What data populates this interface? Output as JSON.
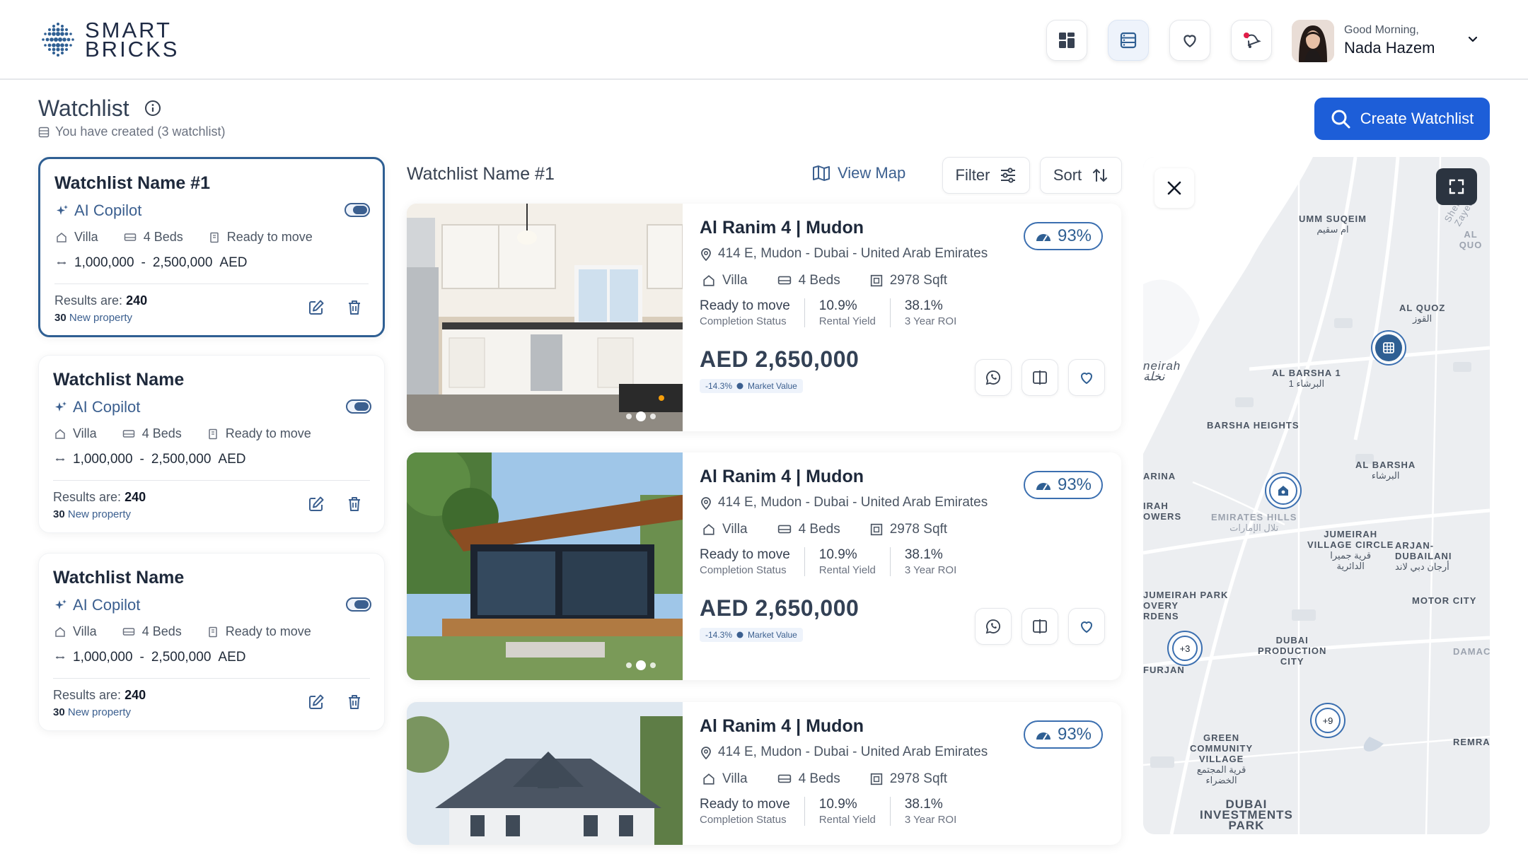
{
  "brand": {
    "line1": "SMART",
    "line2": "BRICKS"
  },
  "user": {
    "greeting": "Good Morning,",
    "name": "Nada Hazem"
  },
  "page": {
    "title": "Watchlist",
    "subtitle": "You have created (3 watchlist)",
    "create_label": "Create Watchlist"
  },
  "watchlists": [
    {
      "name": "Watchlist Name #1",
      "ai": "AI Copilot",
      "type": "Villa",
      "beds": "4 Beds",
      "status": "Ready to move",
      "price_min": "1,000,000",
      "price_sep": "-",
      "price_max": "2,500,000",
      "currency": "AED",
      "results_label": "Results are:",
      "results": "240",
      "new_count": "30",
      "new_label": "New property"
    },
    {
      "name": "Watchlist Name",
      "ai": "AI Copilot",
      "type": "Villa",
      "beds": "4 Beds",
      "status": "Ready to move",
      "price_min": "1,000,000",
      "price_sep": "-",
      "price_max": "2,500,000",
      "currency": "AED",
      "results_label": "Results are:",
      "results": "240",
      "new_count": "30",
      "new_label": "New property"
    },
    {
      "name": "Watchlist Name",
      "ai": "AI Copilot",
      "type": "Villa",
      "beds": "4 Beds",
      "status": "Ready to move",
      "price_min": "1,000,000",
      "price_sep": "-",
      "price_max": "2,500,000",
      "currency": "AED",
      "results_label": "Results are:",
      "results": "240",
      "new_count": "30",
      "new_label": "New property"
    }
  ],
  "list": {
    "title": "Watchlist Name #1",
    "view_map": "View Map",
    "filter": "Filter",
    "sort": "Sort"
  },
  "properties": [
    {
      "title": "Al Ranim 4 | Mudon",
      "address": "414 E, Mudon - Dubai - United Arab Emirates",
      "type": "Villa",
      "beds": "4 Beds",
      "area": "2978 Sqft",
      "score": "93%",
      "status_v": "Ready to move",
      "status_l": "Completion Status",
      "yield_v": "10.9%",
      "yield_l": "Rental Yield",
      "roi_v": "38.1%",
      "roi_l": "3 Year ROI",
      "price": "AED 2,650,000",
      "mv_pct": "-14.3%",
      "mv_label": "Market Value"
    },
    {
      "title": "Al Ranim 4 | Mudon",
      "address": "414 E, Mudon - Dubai - United Arab Emirates",
      "type": "Villa",
      "beds": "4 Beds",
      "area": "2978 Sqft",
      "score": "93%",
      "status_v": "Ready to move",
      "status_l": "Completion Status",
      "yield_v": "10.9%",
      "yield_l": "Rental Yield",
      "roi_v": "38.1%",
      "roi_l": "3 Year ROI",
      "price": "AED 2,650,000",
      "mv_pct": "-14.3%",
      "mv_label": "Market Value"
    },
    {
      "title": "Al Ranim 4 | Mudon",
      "address": "414 E, Mudon - Dubai - United Arab Emirates",
      "type": "Villa",
      "beds": "4 Beds",
      "area": "2978 Sqft",
      "score": "93%",
      "status_v": "Ready to move",
      "status_l": "Completion Status",
      "yield_v": "10.9%",
      "yield_l": "Rental Yield",
      "roi_v": "38.1%",
      "roi_l": "3 Year ROI"
    }
  ],
  "map": {
    "labels": [
      "UMM SUQEIM",
      "ام سقيم",
      "AL QUOZ",
      "القوز",
      "AL QUO",
      "Sheikh Zayed",
      "neirah",
      "نخلة",
      "AL BARSHA 1",
      "البرشاء 1",
      "BARSHA HEIGHTS",
      "AL BARSHA",
      "البرشاء",
      "ARINA",
      "IRAH",
      "OWERS",
      "EMIRATES HILLS",
      "تلال الإمارات",
      "JUMEIRAH",
      "VILLAGE CIRCLE",
      "قرية جميرا",
      "الدائرية",
      "ARJAN-DUBAILANI",
      "أرجان دبي لاند",
      "JUMEIRAH PARK",
      "OVERY",
      "RDENS",
      "MOTOR CITY",
      "DUBAI",
      "PRODUCTION",
      "CITY",
      "DAMAC",
      "FURJAN",
      "GREEN",
      "COMMUNITY",
      "VILLAGE",
      "قرية المجتمع",
      "الخضراء",
      "REMRA",
      "DUBAI",
      "INVESTMENTS",
      "PARK"
    ],
    "clusters": [
      "+3",
      "+9"
    ]
  },
  "icons": {
    "accent": "#1d5ed8",
    "dark": "#2f5f93"
  }
}
